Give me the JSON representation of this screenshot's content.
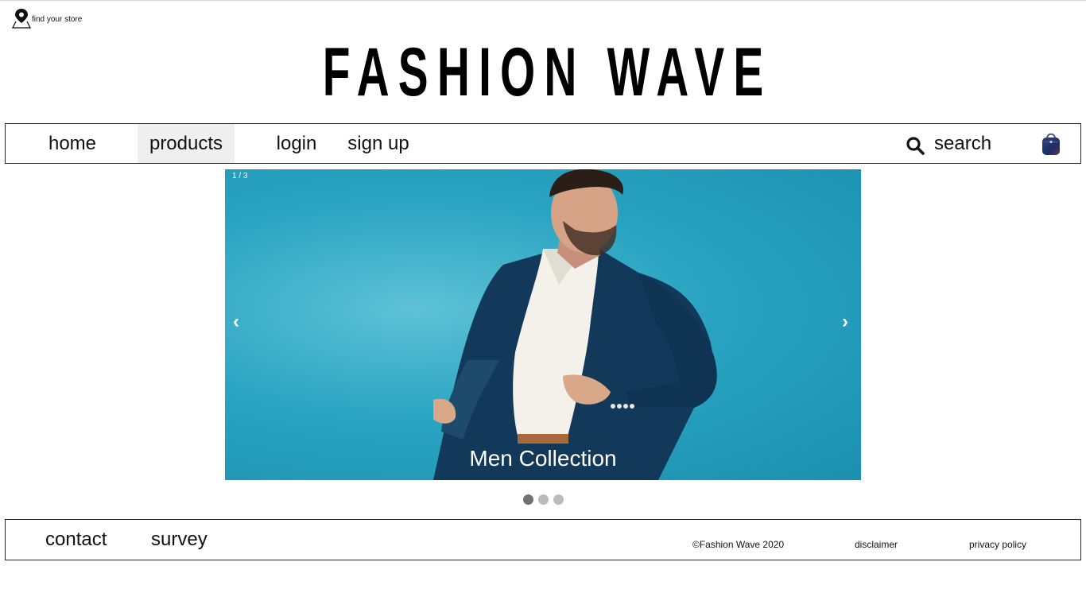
{
  "header": {
    "find_store_label": "find your store",
    "logo_text": "FASHION WAVE"
  },
  "nav": {
    "items": [
      {
        "label": "home"
      },
      {
        "label": "products"
      },
      {
        "label": "login"
      },
      {
        "label": "sign up"
      }
    ],
    "search_label": "search",
    "active_item": "products",
    "icons": [
      "location-pin-icon",
      "search-icon",
      "shopping-bag-icon"
    ]
  },
  "slideshow": {
    "counter": "1 / 3",
    "caption": "Men Collection",
    "prev_label": "‹",
    "next_label": "›",
    "total_slides": 3,
    "active_slide": 1,
    "background_color": "#2aa4c2"
  },
  "footer": {
    "links": [
      {
        "label": "contact"
      },
      {
        "label": "survey"
      }
    ],
    "copyright": "©Fashion Wave 2020",
    "disclaimer": "disclaimer",
    "privacy": "privacy policy"
  },
  "colors": {
    "nav_active_bg": "#efefef",
    "dot_active": "#717171",
    "dot_inactive": "#bbbbbb"
  }
}
